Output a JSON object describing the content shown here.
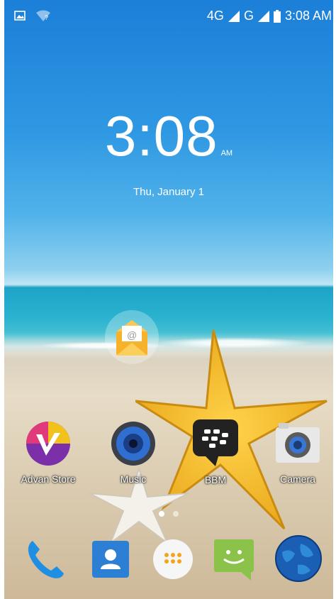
{
  "status_bar": {
    "network_1": "4G",
    "network_2": "G",
    "time": "3:08 AM",
    "icons": [
      "gallery-icon",
      "wifi-question-icon",
      "signal-icon",
      "battery-icon"
    ]
  },
  "lockclock": {
    "time": "3:08",
    "ampm": "AM",
    "date": "Thu, January 1"
  },
  "home_apps": [
    {
      "label": "Advan Store"
    },
    {
      "label": "Music"
    },
    {
      "label": "BBM"
    },
    {
      "label": "Camera"
    }
  ],
  "dock": {
    "items": [
      "phone-icon",
      "contacts-icon",
      "app-drawer-icon",
      "messaging-icon",
      "browser-icon"
    ]
  },
  "page_indicator": {
    "pages": 2,
    "active": 1
  }
}
